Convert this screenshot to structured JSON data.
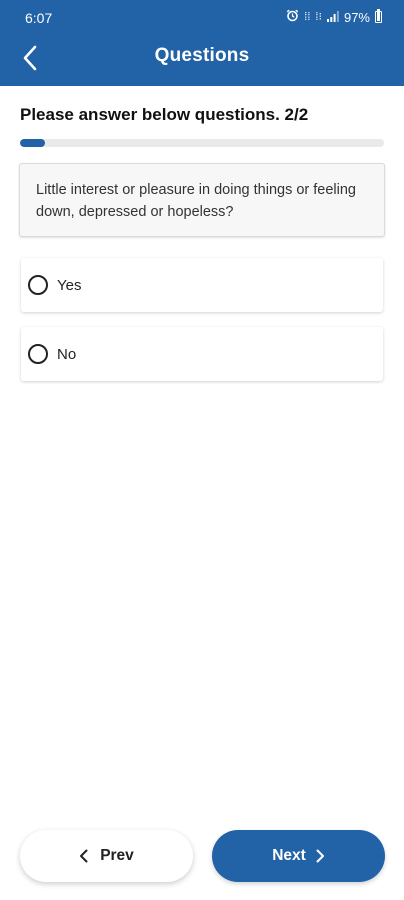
{
  "status_bar": {
    "time": "6:07",
    "battery": "97%",
    "icons": [
      "alarm-icon",
      "volte-icon",
      "lte-icon",
      "signal-icon",
      "battery-icon"
    ]
  },
  "header": {
    "title": "Questions",
    "back_icon": "chevron-left-icon",
    "background": "#2262a6"
  },
  "questionnaire": {
    "instruction": "Please answer below questions. 2/2",
    "progress_fraction": 0.07,
    "question": "Little interest or pleasure in doing things or feeling down, depressed or hopeless?",
    "options": [
      {
        "label": "Yes",
        "selected": false
      },
      {
        "label": "No",
        "selected": false
      }
    ]
  },
  "footer": {
    "prev_label": "Prev",
    "next_label": "Next",
    "accent": "#2262a6"
  }
}
